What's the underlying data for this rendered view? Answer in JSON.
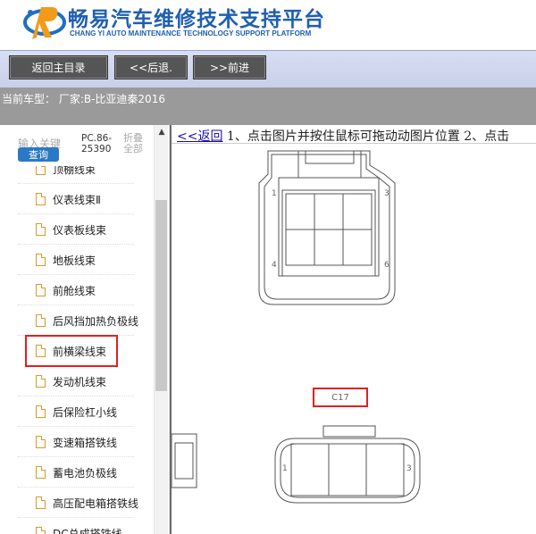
{
  "header": {
    "title_cn": "畅易汽车维修技术支持平台",
    "title_en": "CHANG YI AUTO MAINTENANCE TECHNOLOGY SUPPORT PLATFORM"
  },
  "toolbar": {
    "home_label": "返回主目录",
    "back_label": "<<后退.",
    "forward_label": ">>前进"
  },
  "vehicle": {
    "label": "当前车型：  厂家:B-比亚迪秦2016"
  },
  "sidebar": {
    "search_label": "输入关键",
    "search_button": "查询",
    "pc_code": "PC.86-25390",
    "collapse": "折叠全部",
    "items": [
      {
        "label": "顶棚线束"
      },
      {
        "label": "仪表线束Ⅱ"
      },
      {
        "label": "仪表板线束"
      },
      {
        "label": "地板线束"
      },
      {
        "label": "前舱线束"
      },
      {
        "label": "后风挡加热负极线"
      },
      {
        "label": "前横梁线束"
      },
      {
        "label": "发动机线束"
      },
      {
        "label": "后保险杠小线"
      },
      {
        "label": "变速箱搭铁线"
      },
      {
        "label": "蓄电池负极线"
      },
      {
        "label": "高压配电箱搭铁线"
      },
      {
        "label": "DC总成搭铁线"
      }
    ],
    "selected_index": 6
  },
  "main": {
    "back_link": "<<返回",
    "instruction": " 1、点击图片并按住鼠标可拖动动图片位置 2、点击",
    "connector_top": {
      "pin_labels": [
        "1",
        "4",
        "3",
        "6"
      ]
    },
    "connector_bottom": {
      "id_label": "C17",
      "pin_labels": [
        "1",
        "3"
      ]
    }
  },
  "colors": {
    "brand_blue": "#1f5fb0",
    "highlight_red": "#e02020",
    "toolbar_button": "#555555"
  }
}
